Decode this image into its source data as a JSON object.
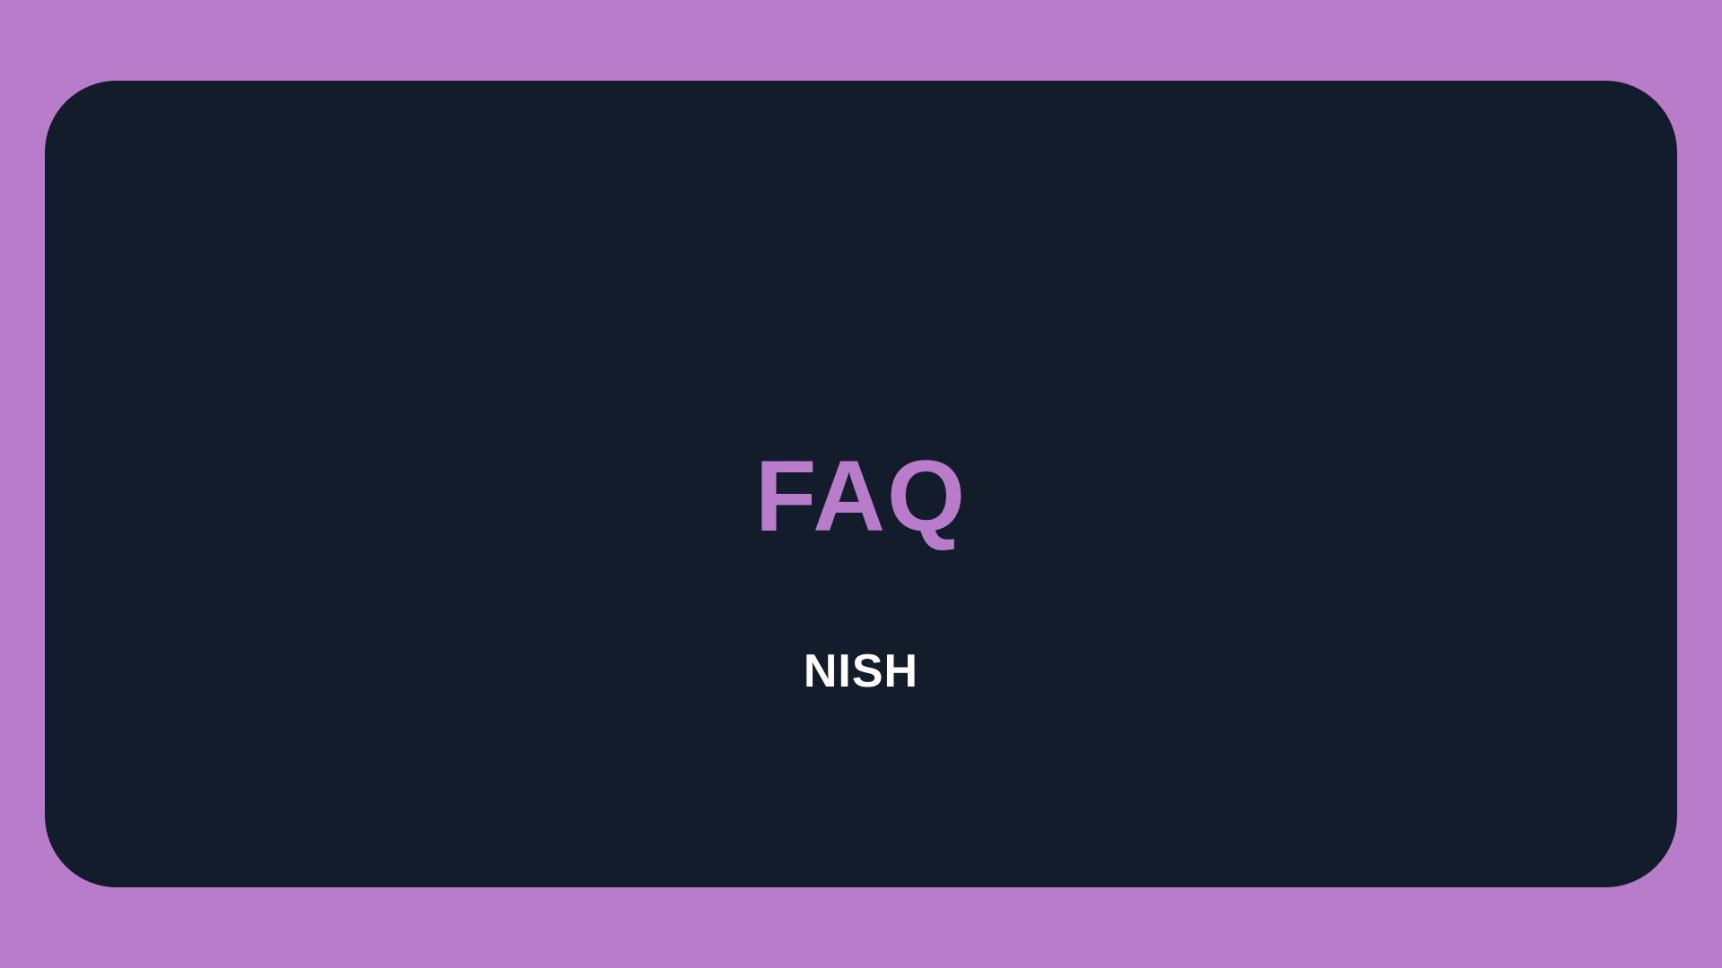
{
  "page": {
    "background_color": "#B87CCB",
    "card_color": "#131C2A"
  },
  "slide": {
    "title": "FAQ",
    "title_color": "#B87CCB",
    "subtitle": "NISH",
    "subtitle_color": "#FFFFFF"
  }
}
